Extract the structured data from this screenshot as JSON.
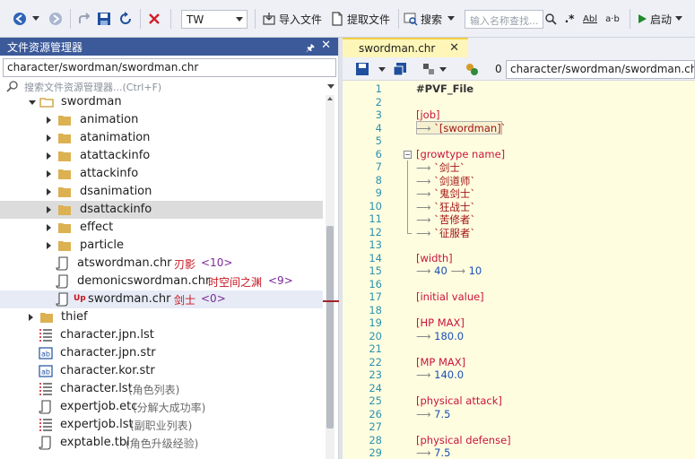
{
  "toolbar": {
    "combo_value": "TW",
    "import_label": "导入文件",
    "extract_label": "提取文件",
    "search_label": "搜索",
    "search_placeholder": "输入名称查找...",
    "regex_label": ".*",
    "case_label": "Abl",
    "word_label": "a·b",
    "run_label": "启动"
  },
  "explorer": {
    "title": "文件资源管理器",
    "path": "character/swordman/swordman.chr",
    "search_placeholder": "搜索文件资源管理器...(Ctrl+F)",
    "rows": [
      {
        "label": "swordman"
      },
      {
        "label": "animation"
      },
      {
        "label": "atanimation"
      },
      {
        "label": "atattackinfo"
      },
      {
        "label": "attackinfo"
      },
      {
        "label": "dsanimation"
      },
      {
        "label": "dsattackinfo"
      },
      {
        "label": "effect"
      },
      {
        "label": "particle"
      },
      {
        "label": "atswordman.chr",
        "tag": "刃影",
        "count": "<10>"
      },
      {
        "label": "demonicswordman.chr",
        "tag": "时空间之渊",
        "count": "<9>"
      },
      {
        "label": "swordman.chr",
        "badge": "Up",
        "tag": "剑士",
        "count": "<0>"
      },
      {
        "label": "thief"
      },
      {
        "label": "character.jpn.lst"
      },
      {
        "label": "character.jpn.str"
      },
      {
        "label": "character.kor.str"
      },
      {
        "label": "character.lst",
        "note": "(角色列表)"
      },
      {
        "label": "expertjob.etc",
        "note": "(分解大成功率)"
      },
      {
        "label": "expertjob.lst",
        "note": "(副职业列表)"
      },
      {
        "label": "exptable.tbl",
        "note": "(角色升级经验)"
      }
    ]
  },
  "editor": {
    "tab_label": "swordman.chr",
    "counter": "0",
    "path": "character/swordman/swordman.chr",
    "lines": [
      {
        "n": "1",
        "text": "#PVF_File"
      },
      {
        "n": "2",
        "text": ""
      },
      {
        "n": "3",
        "text": "[job]"
      },
      {
        "n": "4",
        "text": "`[swordman]`"
      },
      {
        "n": "5",
        "text": ""
      },
      {
        "n": "6",
        "text": "[growtype name]"
      },
      {
        "n": "7",
        "text": "`剑士`"
      },
      {
        "n": "8",
        "text": "`剑道师`"
      },
      {
        "n": "9",
        "text": "`鬼剑士`"
      },
      {
        "n": "10",
        "text": "`狂战士`"
      },
      {
        "n": "11",
        "text": "`苦修者`"
      },
      {
        "n": "12",
        "text": "`征服者`"
      },
      {
        "n": "13",
        "text": ""
      },
      {
        "n": "14",
        "text": "[width]"
      },
      {
        "n": "15",
        "text": "40",
        "text2": "10"
      },
      {
        "n": "16",
        "text": ""
      },
      {
        "n": "17",
        "text": "[initial value]"
      },
      {
        "n": "18",
        "text": ""
      },
      {
        "n": "19",
        "text": "[HP MAX]"
      },
      {
        "n": "20",
        "text": "180.0"
      },
      {
        "n": "21",
        "text": ""
      },
      {
        "n": "22",
        "text": "[MP MAX]"
      },
      {
        "n": "23",
        "text": "140.0"
      },
      {
        "n": "24",
        "text": ""
      },
      {
        "n": "25",
        "text": "[physical attack]"
      },
      {
        "n": "26",
        "text": "7.5"
      },
      {
        "n": "27",
        "text": ""
      },
      {
        "n": "28",
        "text": "[physical defense]"
      },
      {
        "n": "29",
        "text": "7.5"
      }
    ]
  },
  "colors": {
    "title_bar": "#3c5a9a",
    "tab_active": "#fdf6b8",
    "tab_accent": "#f2cf46",
    "section": "#c8143c",
    "string": "#a31515",
    "number": "#1a4fb5",
    "line_number": "#2b91af"
  },
  "arrow_glyph": "⟶"
}
